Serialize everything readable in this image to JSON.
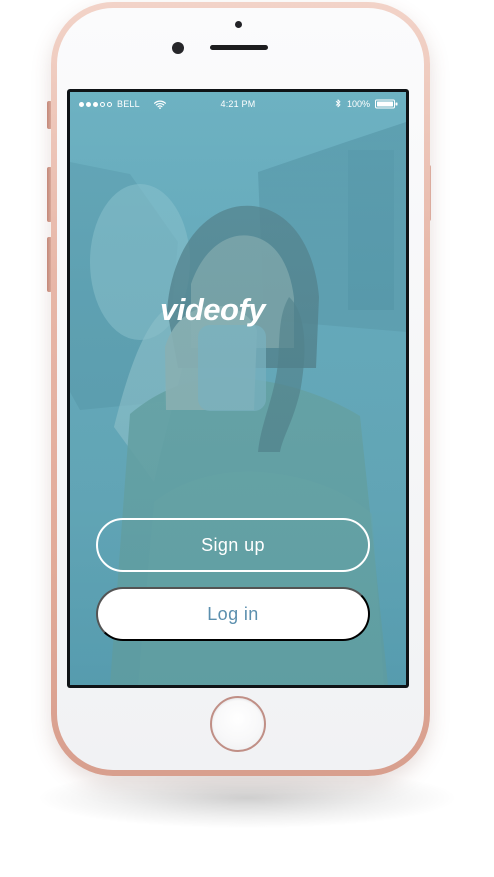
{
  "status_bar": {
    "carrier": "BELL",
    "time": "4:21 PM",
    "battery_percent": "100%",
    "signal_strength": "3/5",
    "icons": [
      "signal-dots-icon",
      "wifi-icon",
      "bluetooth-icon",
      "battery-icon"
    ]
  },
  "logo": {
    "text": "videofy"
  },
  "buttons": {
    "signup_label": "Sign up",
    "login_label": "Log in"
  },
  "colors": {
    "phone_body": "#e7b7a8",
    "screen_tint": "#65b7ca",
    "login_text": "#5b8fae",
    "button_light": "#ffffff"
  }
}
